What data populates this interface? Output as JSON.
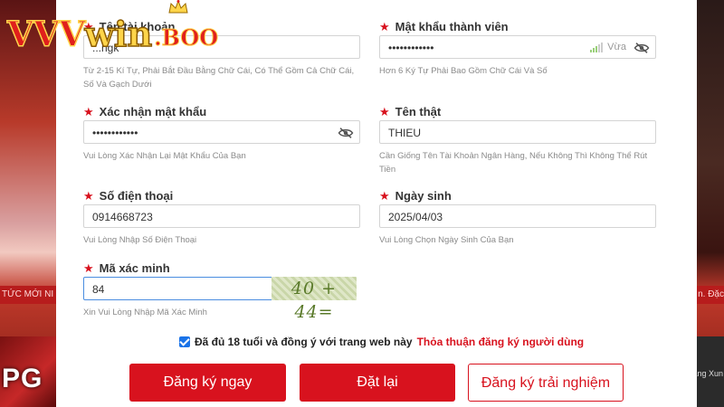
{
  "brand": {
    "logo_text_vvv": "VVV",
    "logo_text_win": "win",
    "logo_text_boo": ".BOO",
    "icon": "crown-icon"
  },
  "background": {
    "ticker_left": "TỨC MỚI NI",
    "ticker_right": "n. Đặc",
    "game_left": "PG",
    "game_right": "ăng Xun"
  },
  "form": {
    "username": {
      "label": "Tên tài khoản",
      "value": "...ngk",
      "hint": "Từ 2-15 Kí Tự, Phải Bắt Đầu Bằng Chữ Cái, Có Thể Gồm Cả Chữ Cái, Số Và Gạch Dưới"
    },
    "password": {
      "label": "Mật khẩu thành viên",
      "value": "••••••••••••",
      "strength": "Vừa",
      "hint": "Hơn 6 Ký Tự Phải Bao Gồm Chữ Cái Và Số"
    },
    "confirm_password": {
      "label": "Xác nhận mật khẩu",
      "value": "••••••••••••",
      "hint": "Vui Lòng Xác Nhận Lại Mật Khẩu Của Bạn"
    },
    "real_name": {
      "label": "Tên thật",
      "value": "THIEU",
      "hint": "Cần Giống Tên Tài Khoản Ngân Hàng, Nếu Không Thì Không Thể Rút Tiền"
    },
    "phone": {
      "label": "Số điện thoại",
      "value": "0914668723",
      "hint": "Vui Lòng Nhập Số Điện Thoại"
    },
    "birthday": {
      "label": "Ngày sinh",
      "value": "2025/04/03",
      "hint": "Vui Lòng Chọn Ngày Sinh Của Bạn"
    },
    "captcha": {
      "label": "Mã xác minh",
      "value": "84",
      "image_text": "40 + 44=",
      "hint": "Xin Vui Lòng Nhập Mã Xác Minh"
    },
    "agree": {
      "text": "Đã đủ 18 tuổi và đồng ý với trang web này",
      "link": "Thỏa thuận đăng ký người dùng",
      "checked": true
    },
    "buttons": {
      "register": "Đăng ký ngay",
      "reset": "Đặt lại",
      "trial": "Đăng ký trải nghiệm"
    }
  },
  "colors": {
    "accent": "#d8121e",
    "checkbox": "#1a73e8",
    "strength_bar": "#9ad07a"
  }
}
